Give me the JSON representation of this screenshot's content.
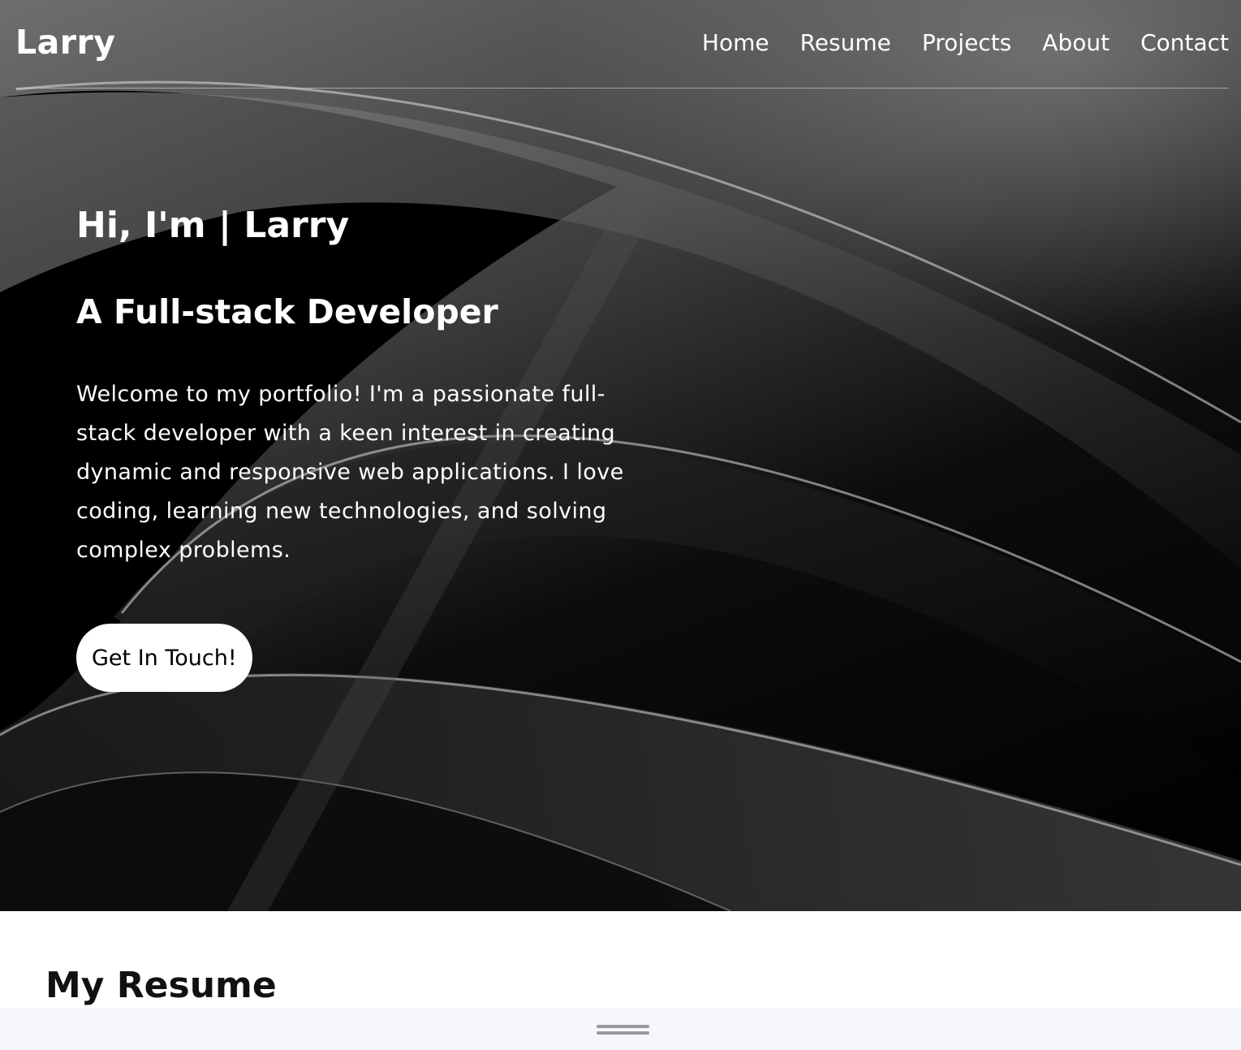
{
  "brand": "Larry",
  "nav": {
    "items": [
      {
        "label": "Home"
      },
      {
        "label": "Resume"
      },
      {
        "label": "Projects"
      },
      {
        "label": "About"
      },
      {
        "label": "Contact"
      }
    ]
  },
  "hero": {
    "greeting": "Hi, I'm | Larry",
    "role": "A Full-stack Developer",
    "bio": "Welcome to my portfolio! I'm a passionate full-stack developer with a keen interest in creating dynamic and responsive web applications. I love coding, learning new technologies, and solving complex problems.",
    "cta_label": "Get In Touch!"
  },
  "resume": {
    "title": "My Resume"
  },
  "icons": {
    "drag_handle": "drag-handle-icon"
  }
}
